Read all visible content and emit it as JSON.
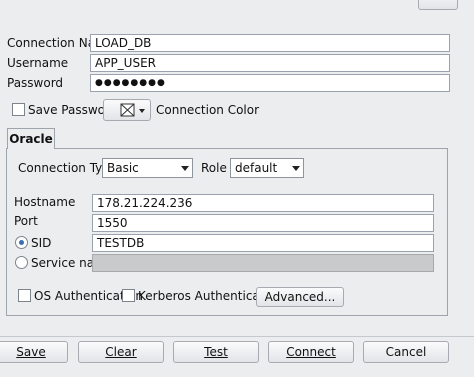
{
  "form": {
    "connection_name_label": "Connection Name",
    "connection_name_value": "LOAD_DB",
    "username_label": "Username",
    "username_value": "APP_USER",
    "password_label": "Password",
    "password_value": "●●●●●●●●",
    "save_password_label": "Save Password",
    "save_password_checked": false,
    "connection_color_label": "Connection Color"
  },
  "tab": {
    "label": "Oracle"
  },
  "oracle": {
    "connection_type_label": "Connection Type",
    "connection_type_value": "Basic",
    "role_label": "Role",
    "role_value": "default",
    "hostname_label": "Hostname",
    "hostname_value": "178.21.224.236",
    "port_label": "Port",
    "port_value": "1550",
    "sid_label": "SID",
    "sid_value": "TESTDB",
    "sid_selected": true,
    "service_name_label": "Service name",
    "service_name_value": "",
    "os_auth_label": "OS Authentication",
    "kerberos_auth_label": "Kerberos Authentication",
    "advanced_label": "Advanced..."
  },
  "buttons": {
    "save": "Save",
    "clear": "Clear",
    "test": "Test",
    "connect": "Connect",
    "cancel": "Cancel"
  }
}
